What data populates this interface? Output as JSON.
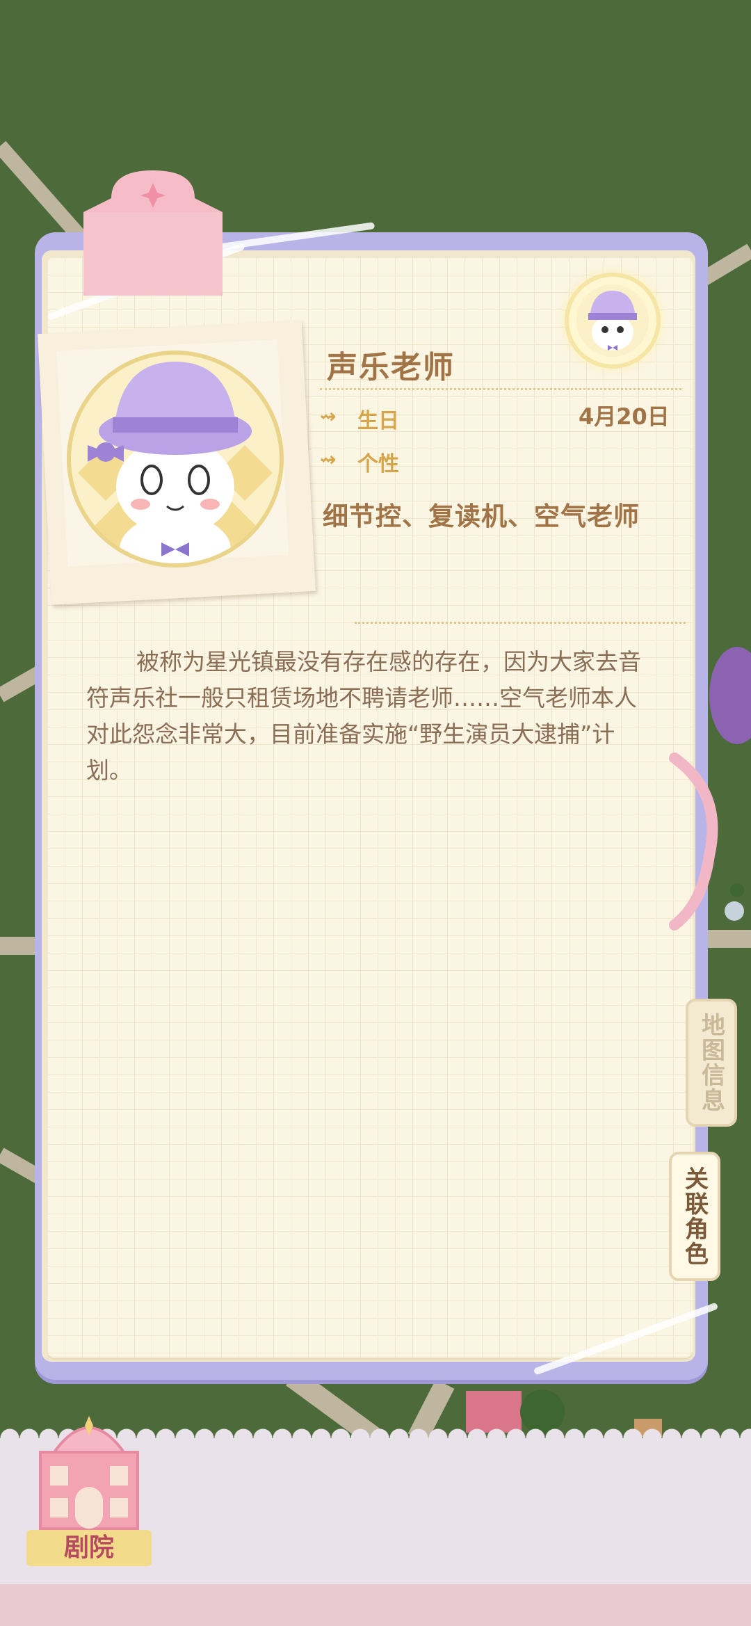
{
  "character": {
    "name": "声乐老师",
    "birthday_label": "生日",
    "birthday_value": "4月20日",
    "personality_label": "个性",
    "traits": "细节控、复读机、空气老师",
    "description": "被称为星光镇最没有存在感的存在，因为大家去音符声乐社一般只租赁场地不聘请老师……空气老师本人对此怨念非常大，目前准备实施“野生演员大逮捕”计划。"
  },
  "side_tabs": {
    "map_info": "地图信息",
    "related_characters": "关联角色"
  },
  "bottom_nav": {
    "location_label": "剧院"
  },
  "colors": {
    "panel_border": "#b9b4e8",
    "page_bg": "#fbf5e3",
    "accent_text": "#a07446",
    "label_gold": "#d5a64a"
  },
  "icons": {
    "row_marker": "sparkle-arrow-icon",
    "pink_tab": "bookmark-tab-icon",
    "theater": "theater-building-icon"
  }
}
